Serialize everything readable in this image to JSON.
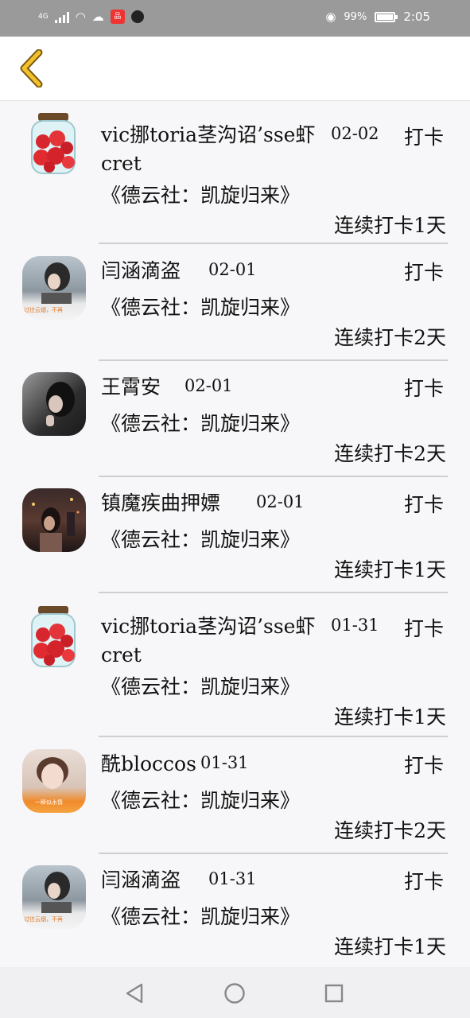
{
  "status_bar": {
    "network": "4G",
    "battery": "99%",
    "time": "2:05"
  },
  "header": {
    "back_icon": "chevron-left-icon"
  },
  "entries": [
    {
      "name": "vic挪toria茎沟诏’sse虾cret",
      "date": "02-02",
      "checkin": "打卡",
      "book": "《德云社：凯旋归来》",
      "streak": "连续打卡1天",
      "avatar": "strawberry-jar"
    },
    {
      "name": "闫涵滴盗",
      "date": "02-01",
      "checkin": "打卡",
      "book": "《德云社：凯旋归来》",
      "streak": "连续打卡2天",
      "avatar": "girl-photo"
    },
    {
      "name": "王霄安",
      "date": "02-01",
      "checkin": "打卡",
      "book": "《德云社：凯旋归来》",
      "streak": "连续打卡2天",
      "avatar": "dark-portrait"
    },
    {
      "name": "镇魔疾曲押嫖",
      "date": "02-01",
      "checkin": "打卡",
      "book": "《德云社：凯旋归来》",
      "streak": "连续打卡1天",
      "avatar": "night-city"
    },
    {
      "name": "vic挪toria茎沟诏’sse虾cret",
      "date": "01-31",
      "checkin": "打卡",
      "book": "《德云社：凯旋归来》",
      "streak": "连续打卡1天",
      "avatar": "strawberry-jar"
    },
    {
      "name": "酰bloccos",
      "date": "01-31",
      "checkin": "打卡",
      "book": "《德云社：凯旋归来》",
      "streak": "连续打卡2天",
      "avatar": "face-photo"
    },
    {
      "name": "闫涵滴盗",
      "date": "01-31",
      "checkin": "打卡",
      "book": "《德云社：凯旋归来》",
      "streak": "连续打卡1天",
      "avatar": "girl-photo"
    }
  ],
  "avatar_texts": {
    "girl_photo_caption": "过往云烟，不再",
    "face_photo_caption": "一瞬似水情"
  },
  "nav": {
    "back": "triangle-back-icon",
    "home": "circle-home-icon",
    "recent": "square-recent-icon"
  }
}
